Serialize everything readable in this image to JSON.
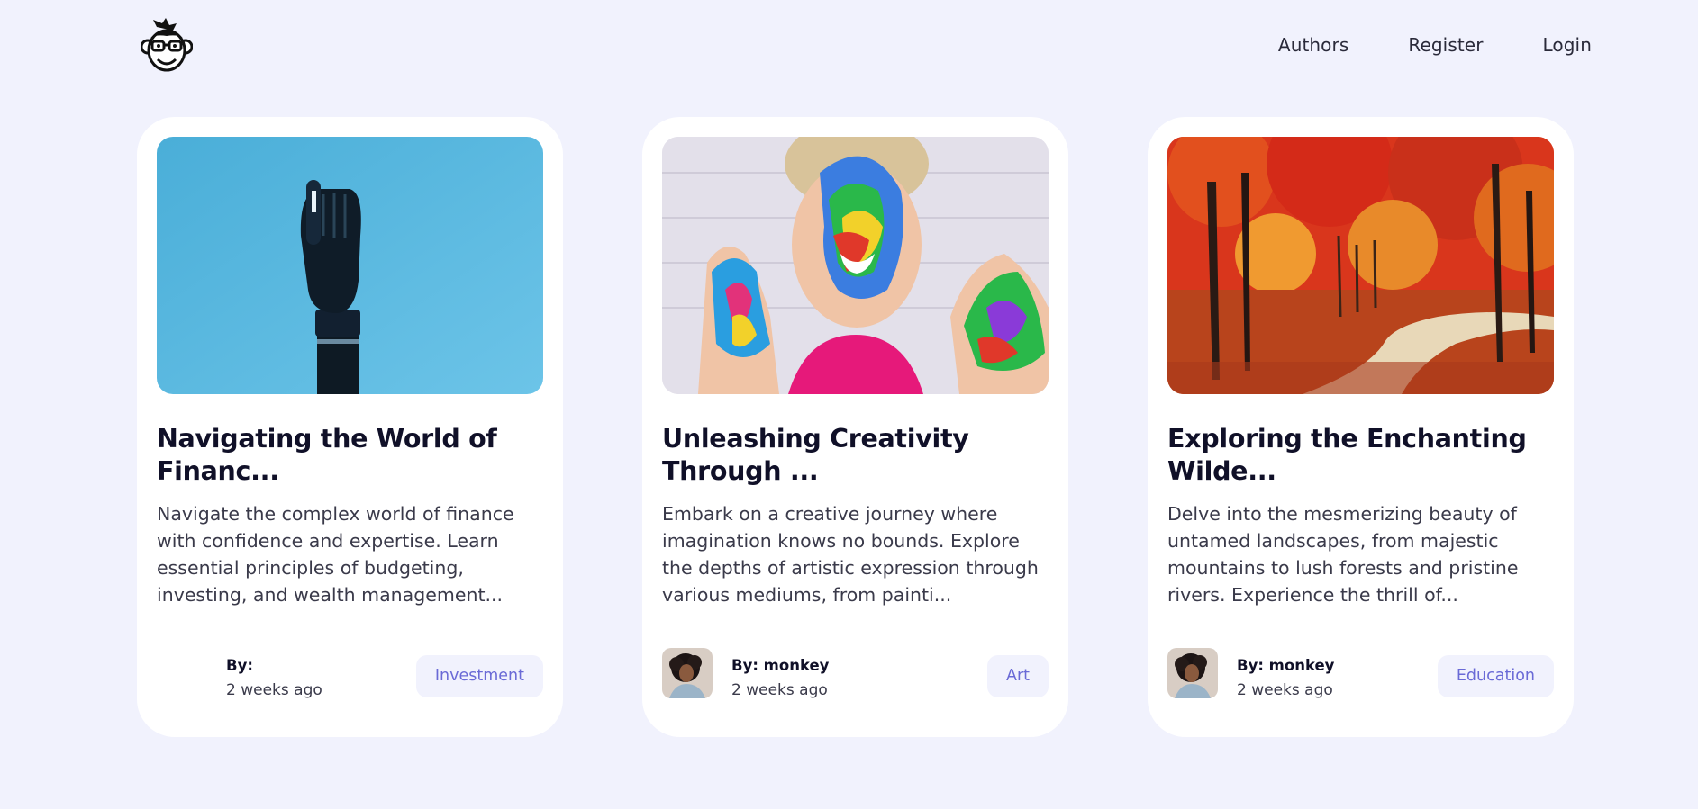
{
  "nav": {
    "logo_icon": "monkey-face-logo-icon",
    "items": [
      {
        "label": "Authors"
      },
      {
        "label": "Register"
      },
      {
        "label": "Login"
      }
    ]
  },
  "cards": [
    {
      "image": "robotic-hand-photo",
      "title": "Navigating the World of Financ...",
      "excerpt": "Navigate the complex world of finance with confidence and expertise. Learn essential principles of budgeting, investing, and wealth management...",
      "author": "By:",
      "time": "2 weeks ago",
      "tag": "Investment"
    },
    {
      "image": "paint-covered-child-photo",
      "title": "Unleashing Creativity Through ...",
      "excerpt": "Embark on a creative journey where imagination knows no bounds. Explore the depths of artistic expression through various mediums, from painti...",
      "author": "By: monkey",
      "time": "2 weeks ago",
      "tag": "Art"
    },
    {
      "image": "autumn-forest-path-photo",
      "title": "Exploring the Enchanting Wilde...",
      "excerpt": "Delve into the mesmerizing beauty of untamed landscapes, from majestic mountains to lush forests and pristine rivers. Experience the thrill of...",
      "author": "By: monkey",
      "time": "2 weeks ago",
      "tag": "Education"
    }
  ],
  "colors": {
    "background": "#f1f2fd",
    "card": "#ffffff",
    "tag_text": "#6a6ad6",
    "tag_bg": "#f1f2fd"
  }
}
